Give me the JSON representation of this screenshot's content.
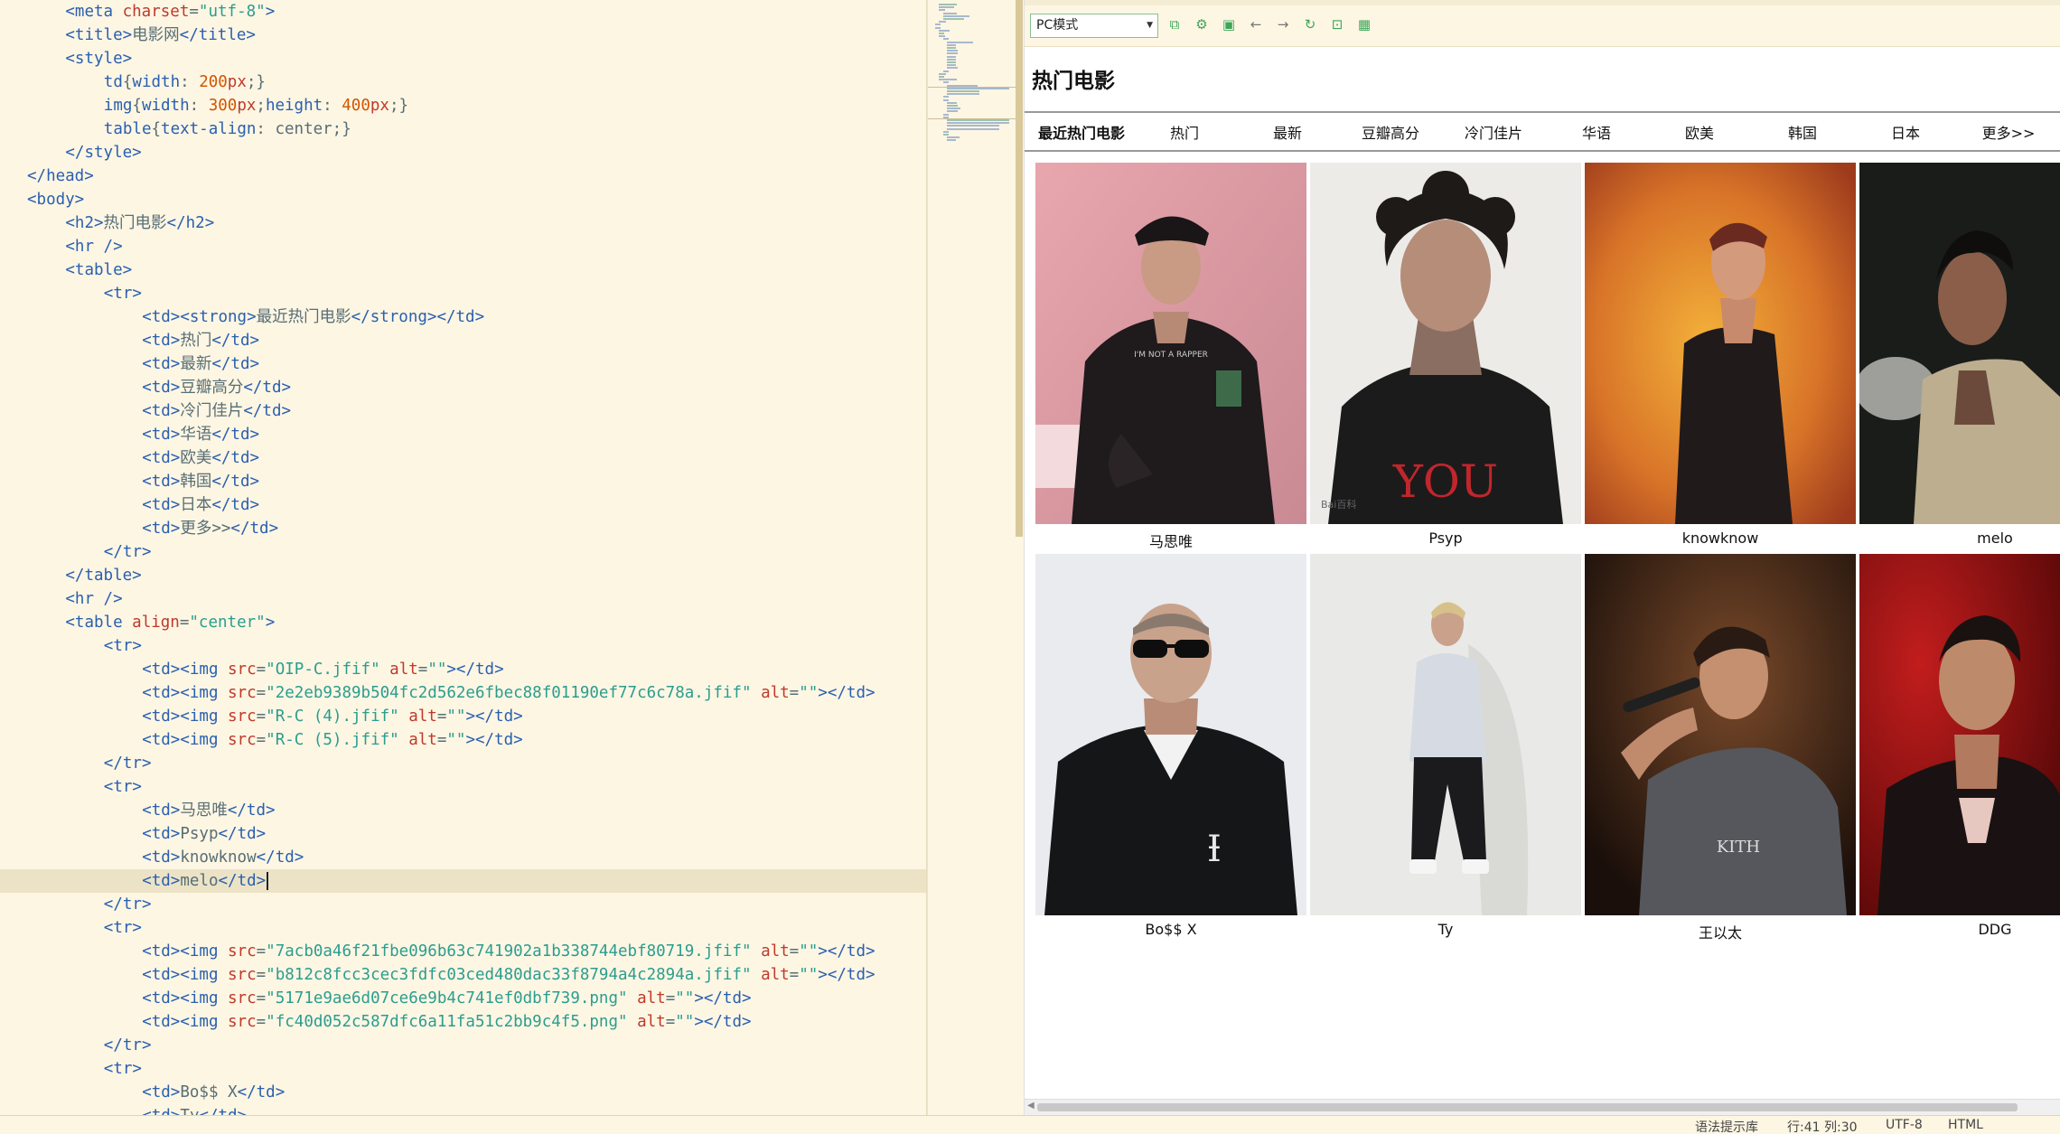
{
  "editor": {
    "lines": [
      {
        "indent": 4,
        "parts": [
          [
            "t",
            "<meta "
          ],
          [
            "a",
            "charset"
          ],
          [
            "x",
            "="
          ],
          [
            "v",
            "\"utf-8\""
          ],
          [
            "t",
            ">"
          ]
        ]
      },
      {
        "indent": 4,
        "parts": [
          [
            "t",
            "<title>"
          ],
          [
            "x",
            "电影网"
          ],
          [
            "t",
            "</title>"
          ]
        ]
      },
      {
        "indent": 4,
        "parts": [
          [
            "t",
            "<style>"
          ]
        ]
      },
      {
        "indent": 8,
        "parts": [
          [
            "t",
            "td"
          ],
          [
            "x",
            "{"
          ],
          [
            "t",
            "width"
          ],
          [
            "x",
            ": "
          ],
          [
            "n",
            "200"
          ],
          [
            "a",
            "px"
          ],
          [
            "x",
            ";}"
          ]
        ]
      },
      {
        "indent": 8,
        "parts": [
          [
            "t",
            "img"
          ],
          [
            "x",
            "{"
          ],
          [
            "t",
            "width"
          ],
          [
            "x",
            ": "
          ],
          [
            "n",
            "300"
          ],
          [
            "a",
            "px"
          ],
          [
            "x",
            ";"
          ],
          [
            "t",
            "height"
          ],
          [
            "x",
            ": "
          ],
          [
            "n",
            "400"
          ],
          [
            "a",
            "px"
          ],
          [
            "x",
            ";}"
          ]
        ]
      },
      {
        "indent": 8,
        "parts": [
          [
            "t",
            "table"
          ],
          [
            "x",
            "{"
          ],
          [
            "t",
            "text-align"
          ],
          [
            "x",
            ": center;}"
          ]
        ]
      },
      {
        "indent": 4,
        "parts": [
          [
            "t",
            "</style>"
          ]
        ]
      },
      {
        "indent": 0,
        "parts": [
          [
            "t",
            "</head>"
          ]
        ]
      },
      {
        "indent": 0,
        "parts": [
          [
            "t",
            "<body>"
          ]
        ]
      },
      {
        "indent": 4,
        "parts": [
          [
            "t",
            "<h2>"
          ],
          [
            "x",
            "热门电影"
          ],
          [
            "t",
            "</h2>"
          ]
        ]
      },
      {
        "indent": 4,
        "parts": [
          [
            "t",
            "<hr />"
          ]
        ]
      },
      {
        "indent": 4,
        "parts": [
          [
            "t",
            "<table>"
          ]
        ]
      },
      {
        "indent": 8,
        "parts": [
          [
            "t",
            "<tr>"
          ]
        ]
      },
      {
        "indent": 12,
        "parts": [
          [
            "t",
            "<td><strong>"
          ],
          [
            "x",
            "最近热门电影"
          ],
          [
            "t",
            "</strong></td>"
          ]
        ]
      },
      {
        "indent": 12,
        "parts": [
          [
            "t",
            "<td>"
          ],
          [
            "x",
            "热门"
          ],
          [
            "t",
            "</td>"
          ]
        ]
      },
      {
        "indent": 12,
        "parts": [
          [
            "t",
            "<td>"
          ],
          [
            "x",
            "最新"
          ],
          [
            "t",
            "</td>"
          ]
        ]
      },
      {
        "indent": 12,
        "parts": [
          [
            "t",
            "<td>"
          ],
          [
            "x",
            "豆瓣高分"
          ],
          [
            "t",
            "</td>"
          ]
        ]
      },
      {
        "indent": 12,
        "parts": [
          [
            "t",
            "<td>"
          ],
          [
            "x",
            "冷门佳片"
          ],
          [
            "t",
            "</td>"
          ]
        ]
      },
      {
        "indent": 12,
        "parts": [
          [
            "t",
            "<td>"
          ],
          [
            "x",
            "华语"
          ],
          [
            "t",
            "</td>"
          ]
        ]
      },
      {
        "indent": 12,
        "parts": [
          [
            "t",
            "<td>"
          ],
          [
            "x",
            "欧美"
          ],
          [
            "t",
            "</td>"
          ]
        ]
      },
      {
        "indent": 12,
        "parts": [
          [
            "t",
            "<td>"
          ],
          [
            "x",
            "韩国"
          ],
          [
            "t",
            "</td>"
          ]
        ]
      },
      {
        "indent": 12,
        "parts": [
          [
            "t",
            "<td>"
          ],
          [
            "x",
            "日本"
          ],
          [
            "t",
            "</td>"
          ]
        ]
      },
      {
        "indent": 12,
        "parts": [
          [
            "t",
            "<td>"
          ],
          [
            "x",
            "更多>>"
          ],
          [
            "t",
            "</td>"
          ]
        ]
      },
      {
        "indent": 8,
        "parts": [
          [
            "t",
            "</tr>"
          ]
        ]
      },
      {
        "indent": 4,
        "parts": [
          [
            "t",
            "</table>"
          ]
        ]
      },
      {
        "indent": 4,
        "parts": [
          [
            "t",
            "<hr />"
          ]
        ]
      },
      {
        "indent": 4,
        "parts": [
          [
            "t",
            "<table "
          ],
          [
            "a",
            "align"
          ],
          [
            "x",
            "="
          ],
          [
            "v",
            "\"center\""
          ],
          [
            "t",
            ">"
          ]
        ]
      },
      {
        "indent": 8,
        "parts": [
          [
            "t",
            "<tr>"
          ]
        ]
      },
      {
        "indent": 12,
        "parts": [
          [
            "t",
            "<td><img "
          ],
          [
            "a",
            "src"
          ],
          [
            "x",
            "="
          ],
          [
            "v",
            "\"OIP-C.jfif\""
          ],
          [
            "t",
            " "
          ],
          [
            "a",
            "alt"
          ],
          [
            "x",
            "="
          ],
          [
            "v",
            "\"\""
          ],
          [
            "t",
            "></td>"
          ]
        ]
      },
      {
        "indent": 12,
        "parts": [
          [
            "t",
            "<td><img "
          ],
          [
            "a",
            "src"
          ],
          [
            "x",
            "="
          ],
          [
            "v",
            "\"2e2eb9389b504fc2d562e6fbec88f01190ef77c6c78a.jfif\""
          ],
          [
            "t",
            " "
          ],
          [
            "a",
            "alt"
          ],
          [
            "x",
            "="
          ],
          [
            "v",
            "\"\""
          ],
          [
            "t",
            "></td>"
          ]
        ]
      },
      {
        "indent": 12,
        "parts": [
          [
            "t",
            "<td><img "
          ],
          [
            "a",
            "src"
          ],
          [
            "x",
            "="
          ],
          [
            "v",
            "\"R-C (4).jfif\""
          ],
          [
            "t",
            " "
          ],
          [
            "a",
            "alt"
          ],
          [
            "x",
            "="
          ],
          [
            "v",
            "\"\""
          ],
          [
            "t",
            "></td>"
          ]
        ]
      },
      {
        "indent": 12,
        "parts": [
          [
            "t",
            "<td><img "
          ],
          [
            "a",
            "src"
          ],
          [
            "x",
            "="
          ],
          [
            "v",
            "\"R-C (5).jfif\""
          ],
          [
            "t",
            " "
          ],
          [
            "a",
            "alt"
          ],
          [
            "x",
            "="
          ],
          [
            "v",
            "\"\""
          ],
          [
            "t",
            "></td>"
          ]
        ]
      },
      {
        "indent": 8,
        "parts": [
          [
            "t",
            "</tr>"
          ]
        ]
      },
      {
        "indent": 8,
        "parts": [
          [
            "t",
            "<tr>"
          ]
        ]
      },
      {
        "indent": 12,
        "parts": [
          [
            "t",
            "<td>"
          ],
          [
            "x",
            "马思唯"
          ],
          [
            "t",
            "</td>"
          ]
        ]
      },
      {
        "indent": 12,
        "parts": [
          [
            "t",
            "<td>"
          ],
          [
            "x",
            "Psyp"
          ],
          [
            "t",
            "</td>"
          ]
        ]
      },
      {
        "indent": 12,
        "parts": [
          [
            "t",
            "<td>"
          ],
          [
            "x",
            "knowknow"
          ],
          [
            "t",
            "</td>"
          ]
        ]
      },
      {
        "indent": 12,
        "parts": [
          [
            "t",
            "<td>"
          ],
          [
            "x",
            "melo"
          ],
          [
            "t",
            "</td>"
          ]
        ],
        "active": true
      },
      {
        "indent": 8,
        "parts": [
          [
            "t",
            "</tr>"
          ]
        ]
      },
      {
        "indent": 8,
        "parts": [
          [
            "t",
            "<tr>"
          ]
        ]
      },
      {
        "indent": 12,
        "parts": [
          [
            "t",
            "<td><img "
          ],
          [
            "a",
            "src"
          ],
          [
            "x",
            "="
          ],
          [
            "v",
            "\"7acb0a46f21fbe096b63c741902a1b338744ebf80719.jfif\""
          ],
          [
            "t",
            " "
          ],
          [
            "a",
            "alt"
          ],
          [
            "x",
            "="
          ],
          [
            "v",
            "\"\""
          ],
          [
            "t",
            "></td>"
          ]
        ]
      },
      {
        "indent": 12,
        "parts": [
          [
            "t",
            "<td><img "
          ],
          [
            "a",
            "src"
          ],
          [
            "x",
            "="
          ],
          [
            "v",
            "\"b812c8fcc3cec3fdfc03ced480dac33f8794a4c2894a.jfif\""
          ],
          [
            "t",
            " "
          ],
          [
            "a",
            "alt"
          ],
          [
            "x",
            "="
          ],
          [
            "v",
            "\"\""
          ],
          [
            "t",
            "></td>"
          ]
        ]
      },
      {
        "indent": 12,
        "parts": [
          [
            "t",
            "<td><img "
          ],
          [
            "a",
            "src"
          ],
          [
            "x",
            "="
          ],
          [
            "v",
            "\"5171e9ae6d07ce6e9b4c741ef0dbf739.png\""
          ],
          [
            "t",
            " "
          ],
          [
            "a",
            "alt"
          ],
          [
            "x",
            "="
          ],
          [
            "v",
            "\"\""
          ],
          [
            "t",
            "></td>"
          ]
        ]
      },
      {
        "indent": 12,
        "parts": [
          [
            "t",
            "<td><img "
          ],
          [
            "a",
            "src"
          ],
          [
            "x",
            "="
          ],
          [
            "v",
            "\"fc40d052c587dfc6a11fa51c2bb9c4f5.png\""
          ],
          [
            "t",
            " "
          ],
          [
            "a",
            "alt"
          ],
          [
            "x",
            "="
          ],
          [
            "v",
            "\"\""
          ],
          [
            "t",
            "></td>"
          ]
        ]
      },
      {
        "indent": 8,
        "parts": [
          [
            "t",
            "</tr>"
          ]
        ]
      },
      {
        "indent": 8,
        "parts": [
          [
            "t",
            "<tr>"
          ]
        ]
      },
      {
        "indent": 12,
        "parts": [
          [
            "t",
            "<td>"
          ],
          [
            "x",
            "Bo$$ X"
          ],
          [
            "t",
            "</td>"
          ]
        ]
      },
      {
        "indent": 12,
        "parts": [
          [
            "t",
            "<td>"
          ],
          [
            "x",
            "Ty"
          ],
          [
            "t",
            "</td>"
          ]
        ]
      }
    ]
  },
  "preview": {
    "mode_select": "PC模式",
    "toolbar_icons": [
      "open-in-browser-icon",
      "settings-icon",
      "console-icon",
      "back-icon",
      "forward-icon",
      "refresh-icon",
      "lock-icon",
      "qr-code-icon"
    ],
    "page_title": "热门电影",
    "nav": [
      "最近热门电影",
      "热门",
      "最新",
      "豆瓣高分",
      "冷门佳片",
      "华语",
      "欧美",
      "韩国",
      "日本",
      "更多>>"
    ],
    "row1_captions": [
      "马思唯",
      "Psyp",
      "knowknow",
      "melo"
    ],
    "row2_captions": [
      "Bo$$ X",
      "Ty",
      "王以太",
      "DDG"
    ],
    "photo_text": {
      "you": "YOU",
      "watermark": "Bai百科",
      "kith": "KITH"
    },
    "colors": {
      "accent_green": "#3ea65a",
      "editor_bg": "#fdf6e3"
    }
  },
  "status": {
    "hint": "语法提示库",
    "position": "行:41  列:30",
    "encoding": "UTF-8",
    "language": "HTML"
  }
}
